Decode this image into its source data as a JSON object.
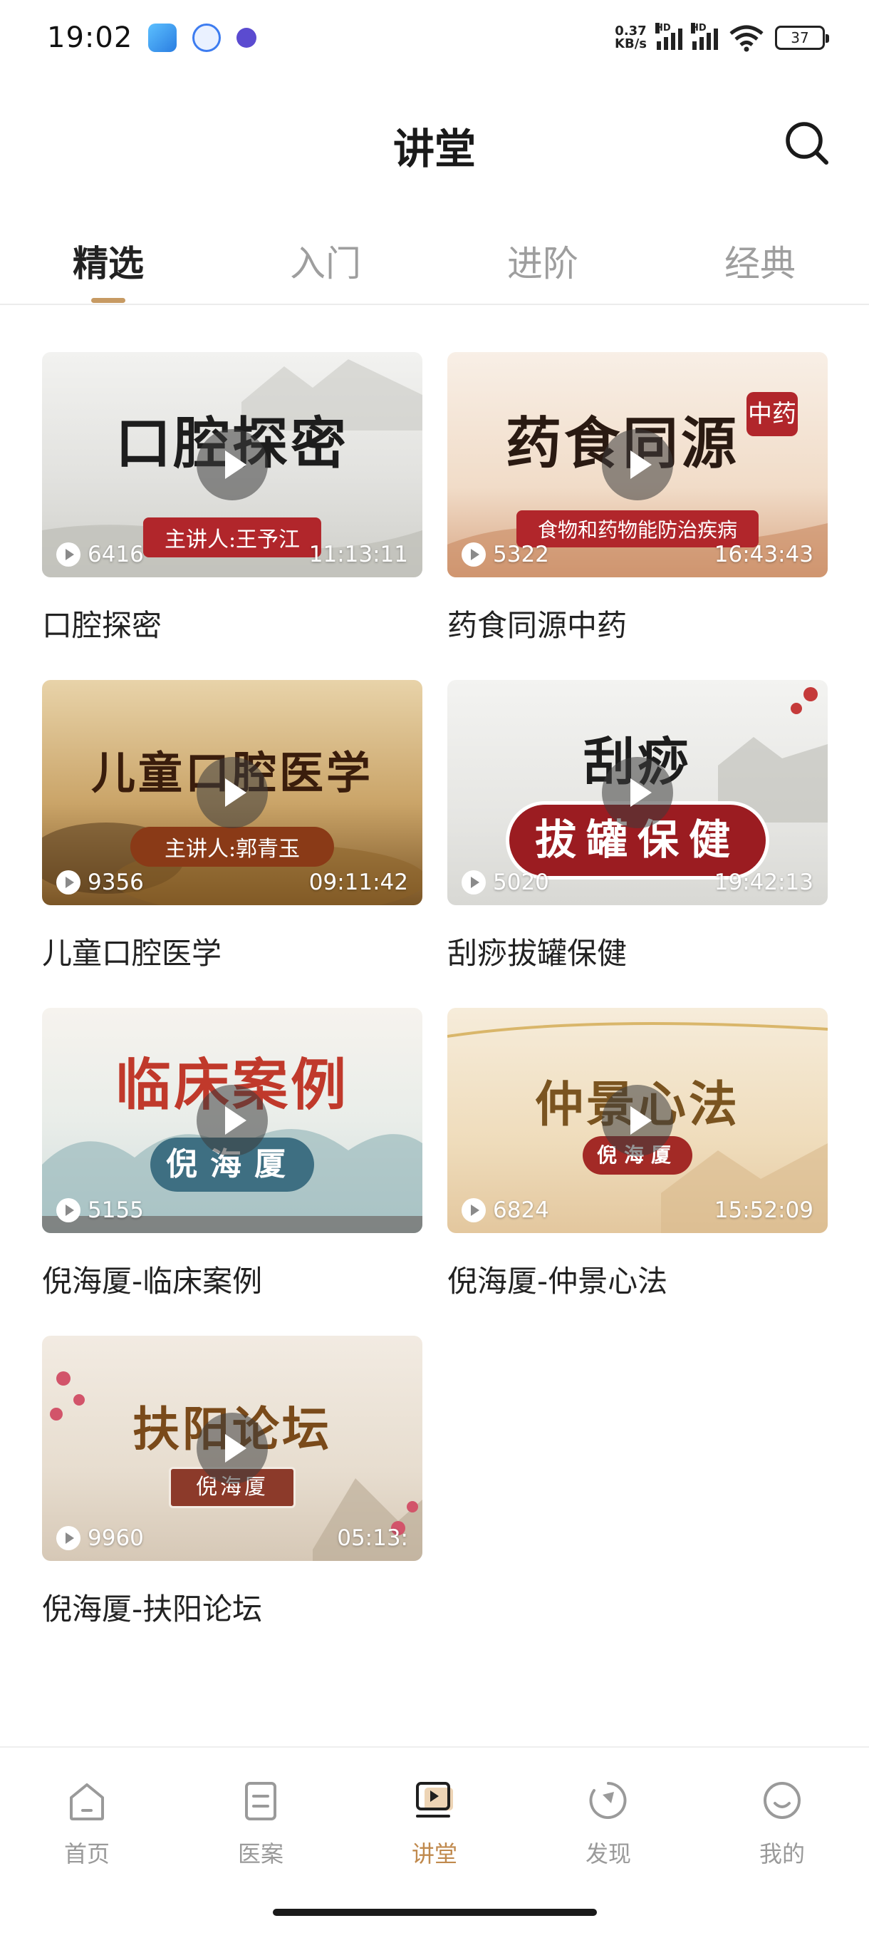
{
  "status_bar": {
    "time": "19:02",
    "net_speed_value": "0.37",
    "net_speed_unit": "KB/s",
    "hd_label": "HD",
    "battery": "37"
  },
  "header": {
    "title": "讲堂"
  },
  "tabs": [
    {
      "label": "精选",
      "active": true
    },
    {
      "label": "入门",
      "active": false
    },
    {
      "label": "进阶",
      "active": false
    },
    {
      "label": "经典",
      "active": false
    }
  ],
  "courses": [
    {
      "thumb_title": "口腔探密",
      "thumb_subtitle": "主讲人:王予江",
      "views": "6416",
      "duration": "11:13:11",
      "title": "口腔探密",
      "accent": "#b1262b"
    },
    {
      "thumb_title": "药食同源",
      "thumb_badge": "中药",
      "thumb_subtitle": "食物和药物能防治疾病",
      "views": "5322",
      "duration": "16:43:43",
      "title": "药食同源中药",
      "accent": "#b1262b"
    },
    {
      "thumb_title": "儿童口腔医学",
      "thumb_subtitle": "主讲人:郭青玉",
      "views": "9356",
      "duration": "09:11:42",
      "title": "儿童口腔医学",
      "accent": "#8a3a17"
    },
    {
      "thumb_title": "刮痧",
      "thumb_subtitle": "拔罐保健",
      "views": "5020",
      "duration": "19:42:13",
      "title": "刮痧拔罐保健",
      "accent": "#9b1c21"
    },
    {
      "thumb_title": "临床案例",
      "thumb_subtitle": "倪海厦",
      "views": "5155",
      "duration": "",
      "title": "倪海厦-临床案例",
      "accent": "#3e6f82"
    },
    {
      "thumb_title": "仲景心法",
      "thumb_subtitle": "倪海厦",
      "views": "6824",
      "duration": "15:52:09",
      "title": "倪海厦-仲景心法",
      "accent": "#a32a26"
    },
    {
      "thumb_title": "扶阳论坛",
      "thumb_subtitle": "倪海厦",
      "views": "9960",
      "duration": "05:13:",
      "title": "倪海厦-扶阳论坛",
      "accent": "#8c3a2a"
    }
  ],
  "bottom_nav": [
    {
      "label": "首页",
      "icon": "home-icon",
      "active": false
    },
    {
      "label": "医案",
      "icon": "document-icon",
      "active": false
    },
    {
      "label": "讲堂",
      "icon": "video-lesson-icon",
      "active": true
    },
    {
      "label": "发现",
      "icon": "compass-icon",
      "active": false
    },
    {
      "label": "我的",
      "icon": "smile-icon",
      "active": false
    }
  ],
  "colors": {
    "accent": "#c08a4e",
    "tab_indicator": "#c79a63",
    "inactive": "#9a9a9a"
  }
}
